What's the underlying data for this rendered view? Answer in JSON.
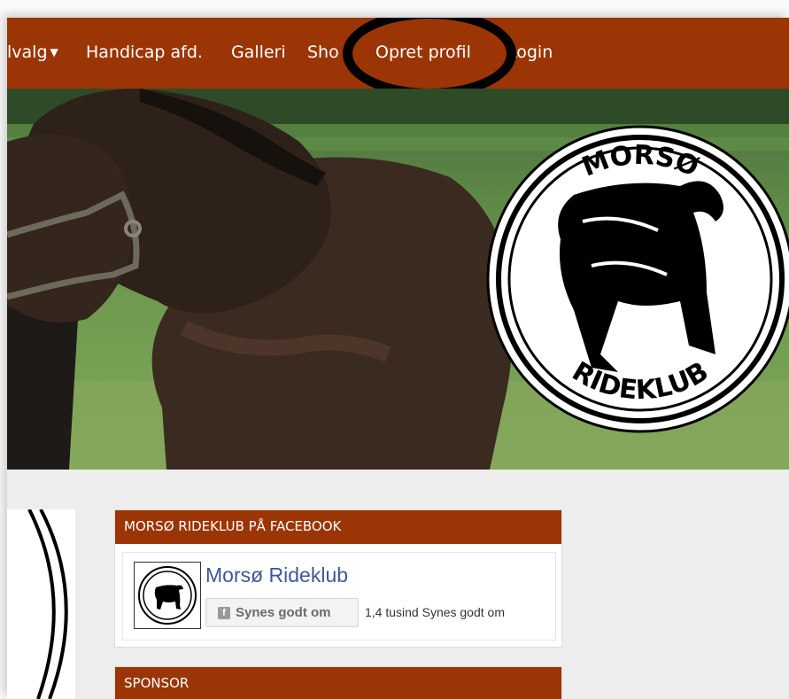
{
  "navbar": {
    "items": [
      {
        "label": "lvalg",
        "has_caret": true
      },
      {
        "label": "Handicap afd."
      },
      {
        "label": "Galleri"
      },
      {
        "label": "Sho"
      },
      {
        "label": "Opret profil"
      },
      {
        "label": "Login"
      }
    ],
    "caret_glyph": "▼",
    "background_color": "#9b3505",
    "highlighted_item": "Opret profil"
  },
  "hero": {
    "logo": {
      "top_text": "MORSØ",
      "bottom_text": "RIDEKLUB"
    }
  },
  "facebook_widget": {
    "heading": "MORSØ RIDEKLUB PÅ FACEBOOK",
    "page_name": "Morsø Rideklub",
    "like_icon": "f",
    "like_button_label": "Synes godt om",
    "like_count_text": "1,4 tusind Synes godt om",
    "link_color": "#3b5998"
  },
  "sponsor": {
    "heading": "SPONSOR"
  },
  "colors": {
    "brand": "#9b3505",
    "page_background": "#ededed"
  }
}
